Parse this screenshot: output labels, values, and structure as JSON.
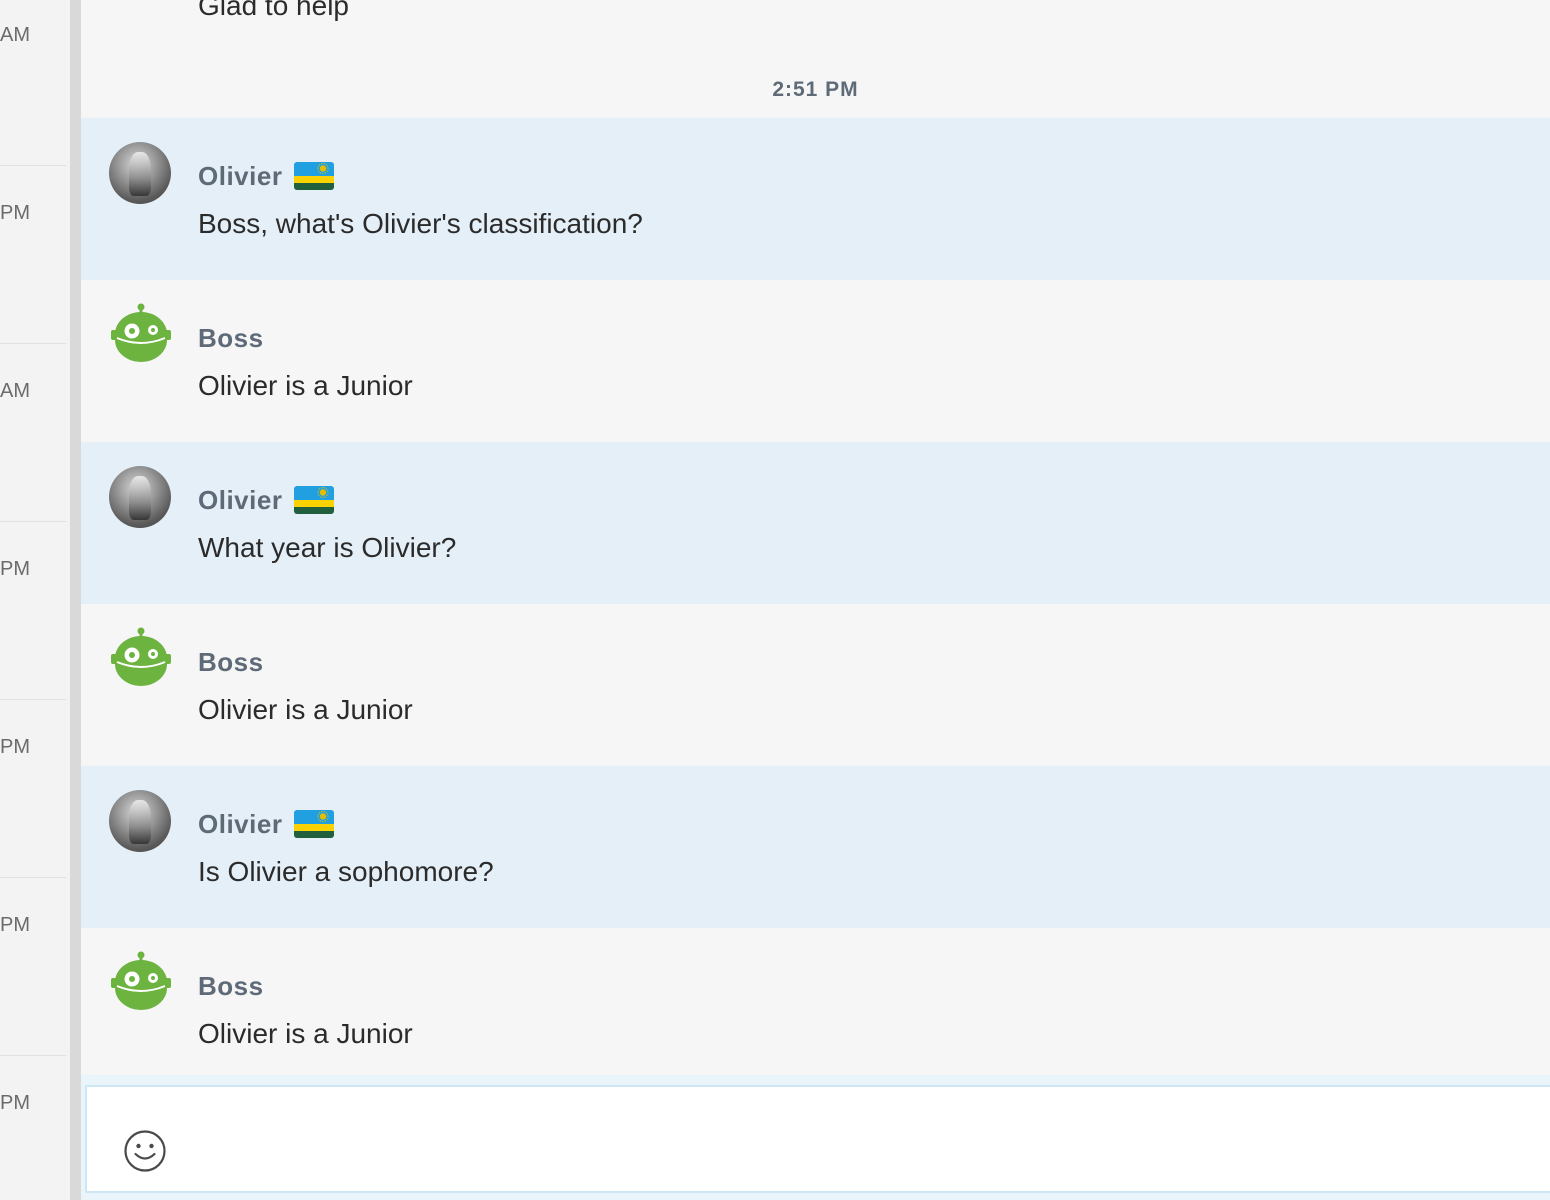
{
  "sidebar": {
    "times": [
      "AM",
      "PM",
      "AM",
      "PM",
      "PM",
      "PM",
      "PM"
    ]
  },
  "chat": {
    "previous_message": "Glad to help",
    "time_separator": "2:51 PM",
    "messages": [
      {
        "sender": "Olivier",
        "text": "Boss, what's Olivier's classification?",
        "role": "user",
        "avatar_icon": "user-photo-avatar",
        "flag_icon": "rwanda-flag-icon"
      },
      {
        "sender": "Boss",
        "text": "Olivier is a Junior",
        "role": "bot",
        "avatar_icon": "bot-robot-avatar"
      },
      {
        "sender": "Olivier",
        "text": "What year is Olivier?",
        "role": "user",
        "avatar_icon": "user-photo-avatar",
        "flag_icon": "rwanda-flag-icon"
      },
      {
        "sender": "Boss",
        "text": "Olivier is a Junior",
        "role": "bot",
        "avatar_icon": "bot-robot-avatar"
      },
      {
        "sender": "Olivier",
        "text": "Is Olivier a sophomore?",
        "role": "user",
        "avatar_icon": "user-photo-avatar",
        "flag_icon": "rwanda-flag-icon"
      },
      {
        "sender": "Boss",
        "text": "Olivier is a Junior",
        "role": "bot",
        "avatar_icon": "bot-robot-avatar"
      }
    ]
  },
  "compose": {
    "value": "",
    "placeholder": "",
    "emoji_icon": "emoji-smiley-icon"
  },
  "colors": {
    "user_message_bg": "#e5eff7",
    "bot_message_bg": "#f6f6f6",
    "sender_name": "#5f6a78",
    "bot_green": "#6cb33f"
  }
}
